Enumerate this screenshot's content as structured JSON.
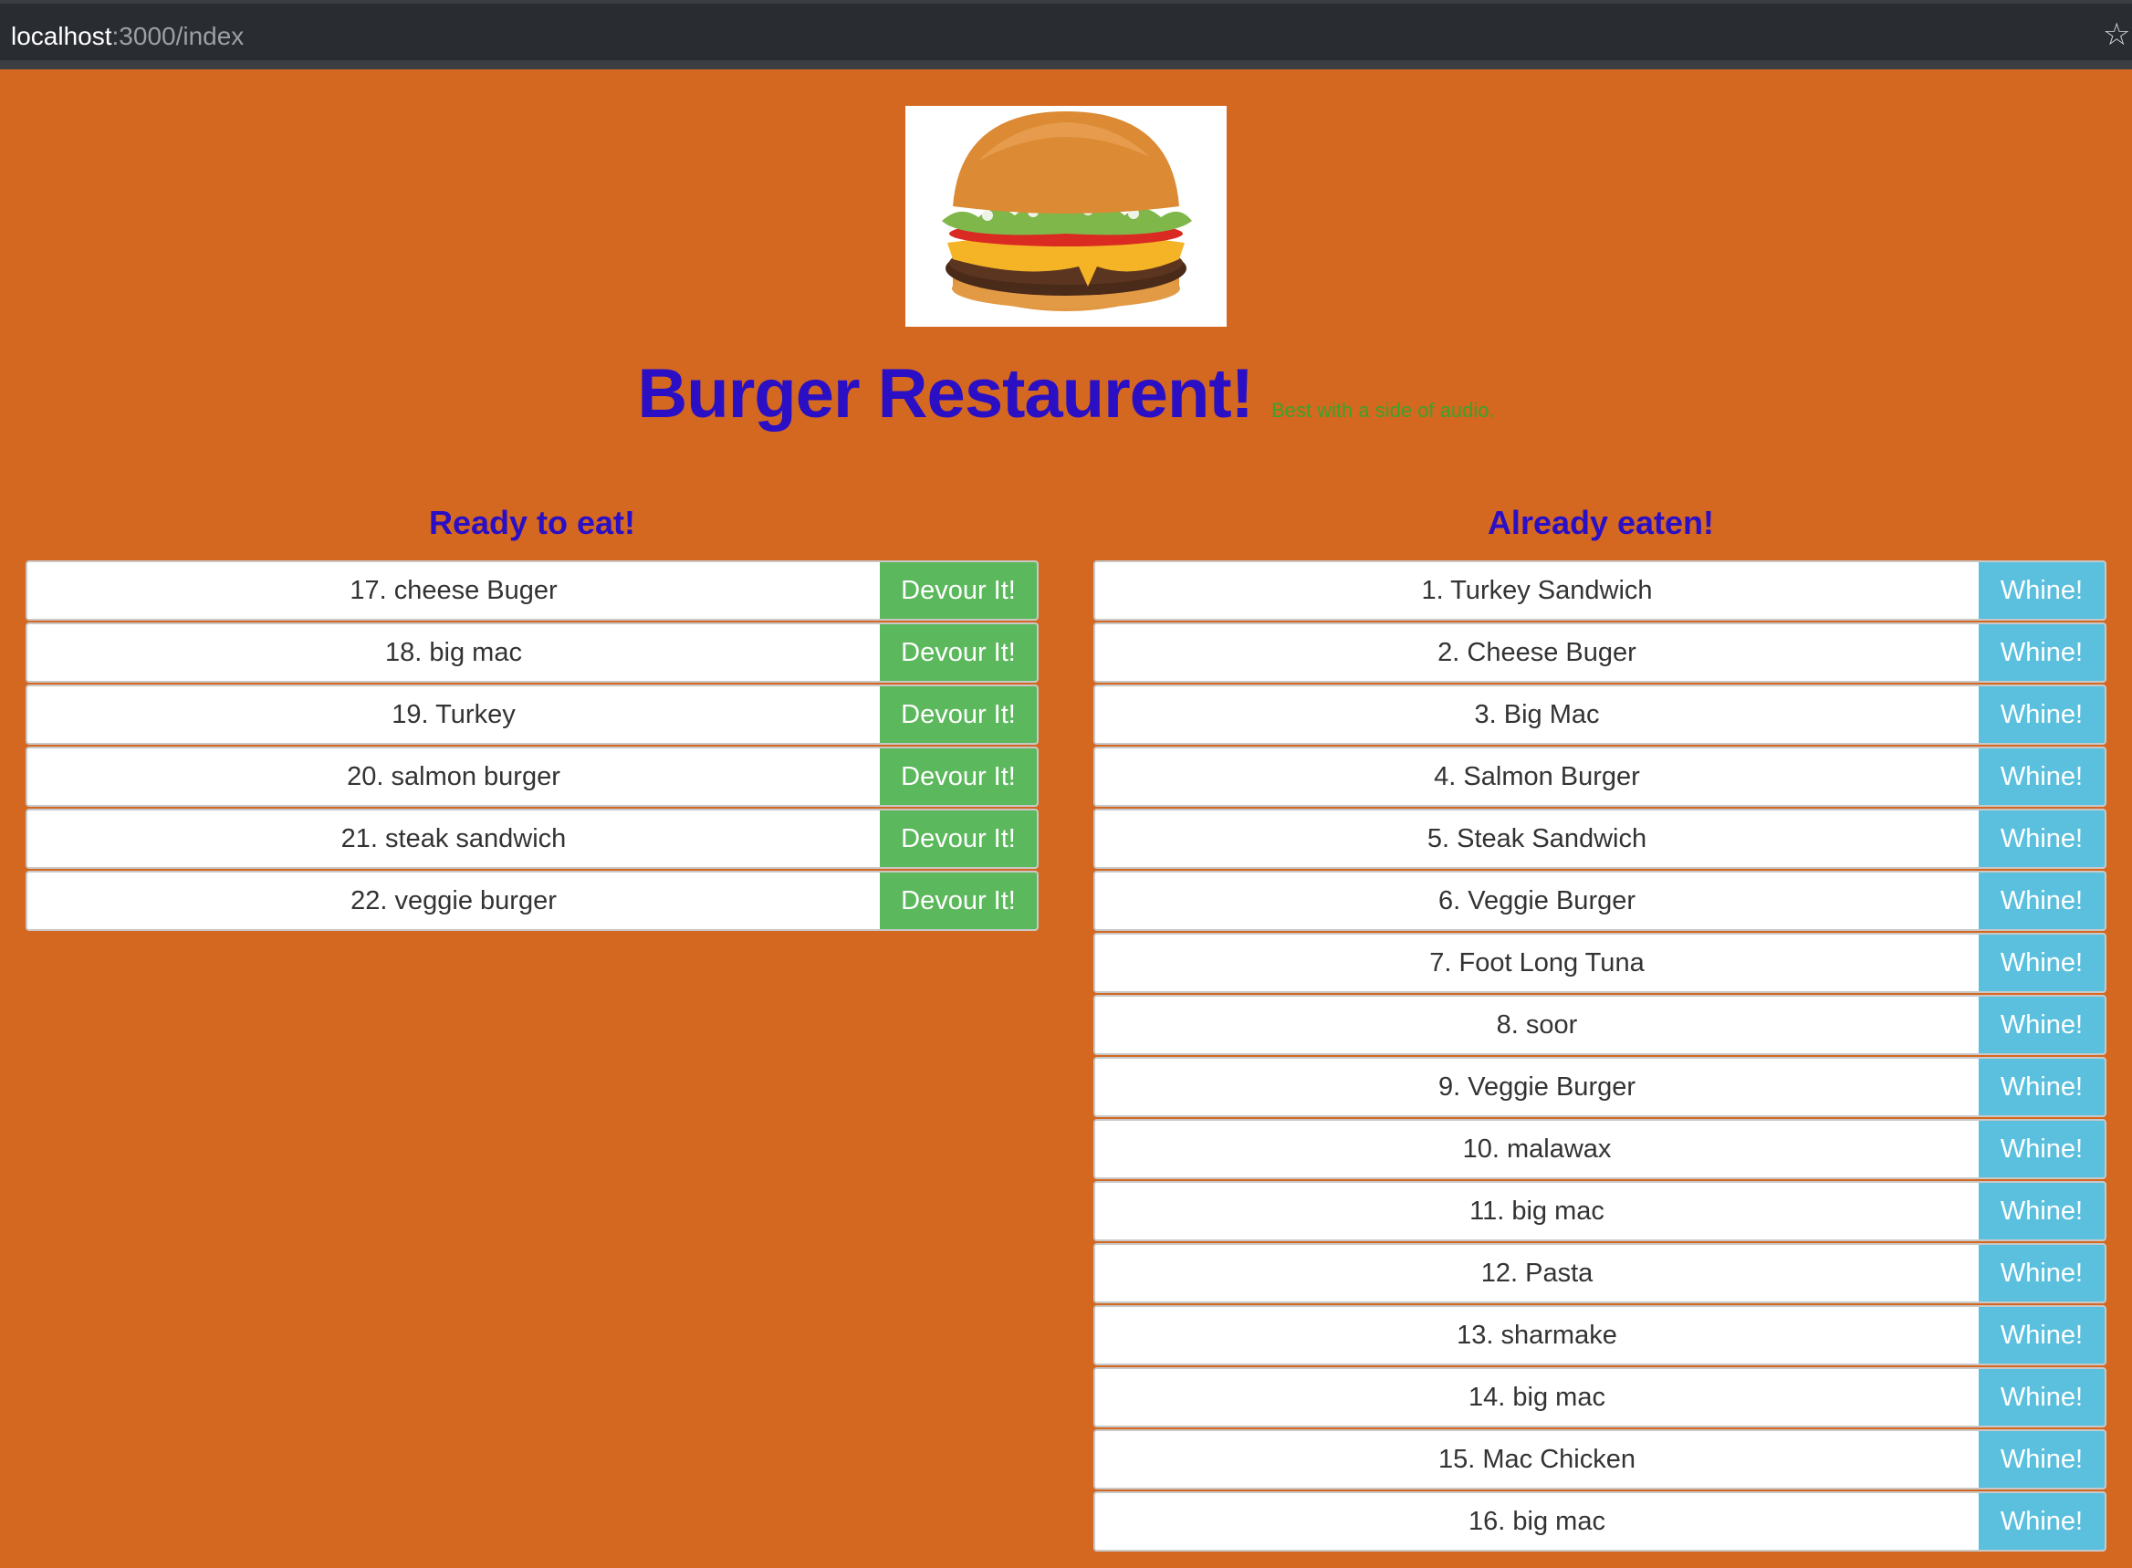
{
  "browser": {
    "url_host": "localhost",
    "url_path": ":3000/index"
  },
  "header": {
    "title": "Burger Restaurent!",
    "subtitle": "Best with a side of audio."
  },
  "ready": {
    "heading": "Ready to eat!",
    "button_label": "Devour It!",
    "items": [
      "17. cheese Buger",
      "18. big mac",
      "19. Turkey",
      "20. salmon burger",
      "21. steak sandwich",
      "22. veggie burger"
    ]
  },
  "eaten": {
    "heading": "Already eaten!",
    "button_label": "Whine!",
    "items": [
      "1. Turkey Sandwich",
      "2. Cheese Buger",
      "3. Big Mac",
      "4. Salmon Burger",
      "5. Steak Sandwich",
      "6. Veggie Burger",
      "7. Foot Long Tuna",
      "8. soor",
      "9. Veggie Burger",
      "10. malawax",
      "11. big mac",
      "12. Pasta",
      "13. sharmake",
      "14. big mac",
      "15. Mac Chicken",
      "16. big mac"
    ]
  },
  "colors": {
    "page_background": "#d46821",
    "title": "#2a0fc4",
    "subtitle": "#3aa32a",
    "devour_button": "#5cb85c",
    "whine_button": "#5bc0de"
  }
}
